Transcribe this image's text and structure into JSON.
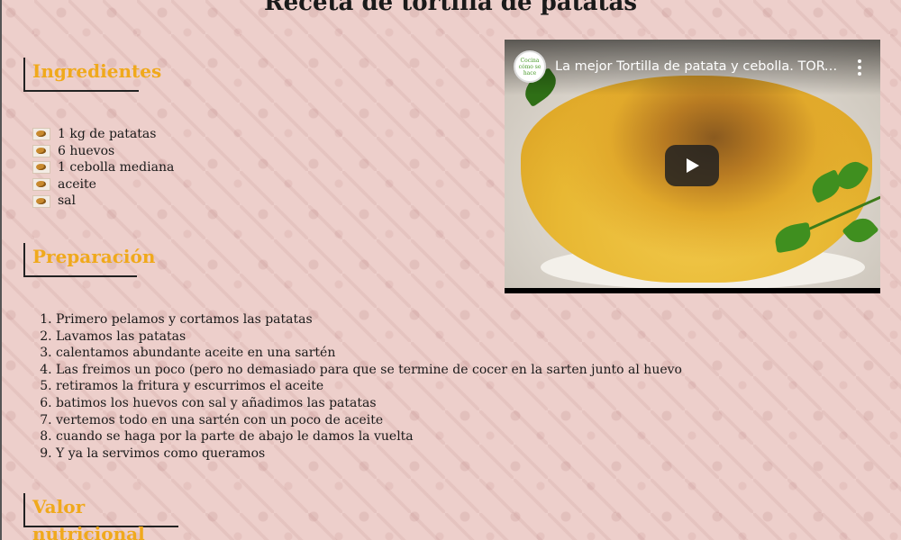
{
  "page": {
    "title": "Receta de tortilla de patatas"
  },
  "sections": {
    "ingredientes": "Ingredientes",
    "preparacion": "Preparación",
    "valor_nutricional": "Valor nutricional"
  },
  "ingredients": [
    "1 kg de patatas",
    "6 huevos",
    "1 cebolla mediana",
    "aceite",
    "sal"
  ],
  "steps": [
    "Primero pelamos y cortamos las patatas",
    "Lavamos las patatas",
    "calentamos abundante aceite en una sartén",
    "Las freimos un poco (pero no demasiado para que se termine de cocer en la sarten junto al huevo",
    "retiramos la fritura y escurrimos el aceite",
    "batimos los huevos con sal y añadimos las patatas",
    "vertemos todo en una sartén con un poco de aceite",
    "cuando se haga por la parte de abajo le damos la vuelta",
    "Y ya la servimos como queramos"
  ],
  "video": {
    "title": "La mejor Tortilla de patata y cebolla. TORTILLA DE PATATAS",
    "channel_logo_text": "Cocina cómo se hace",
    "more_icon": "vertical-dots-icon",
    "play_icon": "play-icon"
  },
  "colors": {
    "heading": "#f0a91c",
    "background": "#edcfcb"
  }
}
